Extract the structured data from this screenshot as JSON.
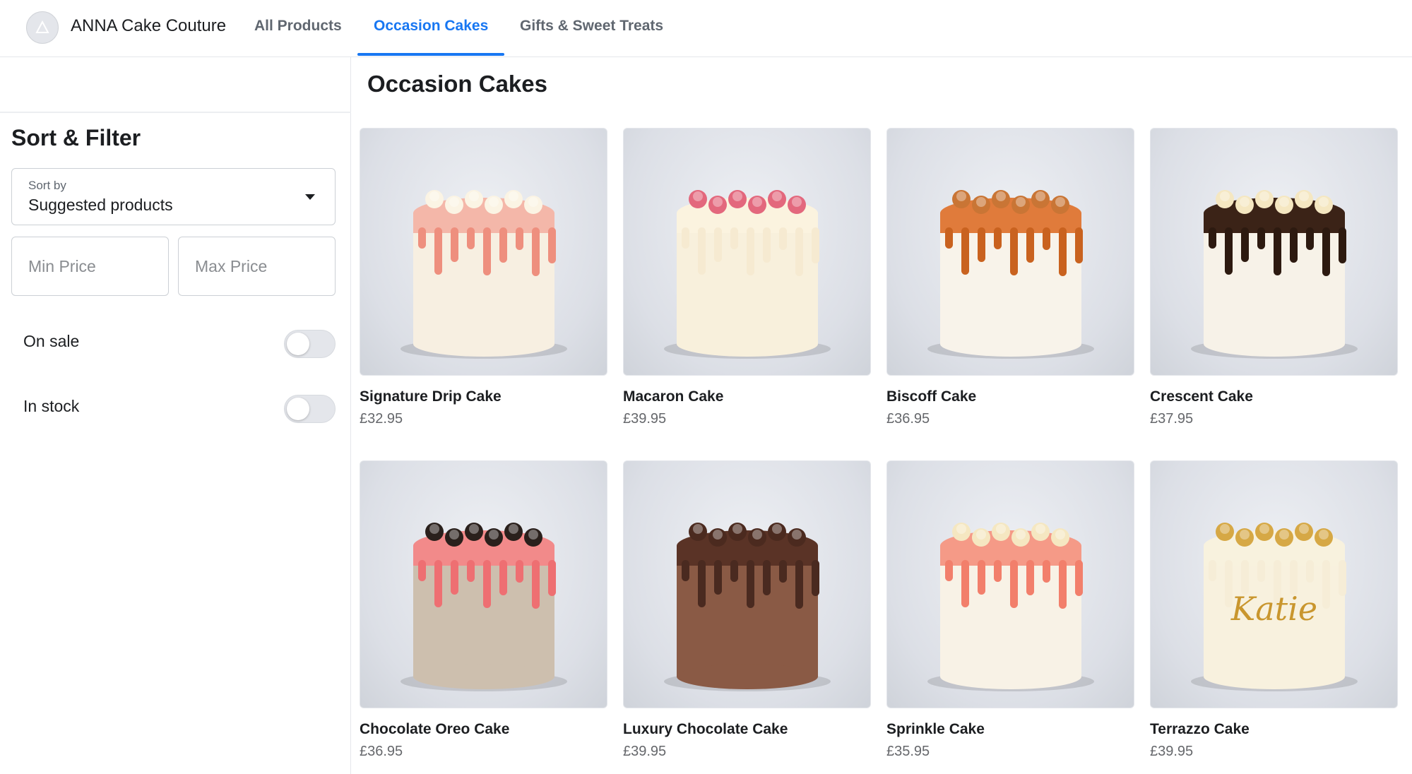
{
  "header": {
    "brand": "ANNA Cake Couture",
    "tabs": [
      {
        "label": "All Products",
        "active": false
      },
      {
        "label": "Occasion Cakes",
        "active": true
      },
      {
        "label": "Gifts & Sweet Treats",
        "active": false
      }
    ]
  },
  "sidebar": {
    "title": "Sort & Filter",
    "sort": {
      "label": "Sort by",
      "value": "Suggested products"
    },
    "min_price": {
      "placeholder": "Min Price",
      "value": ""
    },
    "max_price": {
      "placeholder": "Max Price",
      "value": ""
    },
    "toggles": [
      {
        "label": "On sale",
        "on": false
      },
      {
        "label": "In stock",
        "on": false
      }
    ]
  },
  "main": {
    "title": "Occasion Cakes",
    "products": [
      {
        "name": "Signature Drip Cake",
        "price": "£32.95",
        "icon": "drip-cake-image",
        "frosting": "#f4b7a9",
        "drip": "#ee8f7e",
        "body": "#f7efe1",
        "topper": "#fbf4e4"
      },
      {
        "name": "Macaron Cake",
        "price": "£39.95",
        "icon": "macaron-cake-image",
        "frosting": "#fbf3df",
        "drip": "#f6ead1",
        "body": "#f8f0dc",
        "topper": "#e3687d"
      },
      {
        "name": "Biscoff Cake",
        "price": "£36.95",
        "icon": "biscoff-cake-image",
        "frosting": "#e07b3b",
        "drip": "#c9621f",
        "body": "#f8f3ea",
        "topper": "#c97535"
      },
      {
        "name": "Crescent Cake",
        "price": "£37.95",
        "icon": "crescent-cake-image",
        "frosting": "#3b2317",
        "drip": "#2d1a10",
        "body": "#f7f2e8",
        "topper": "#f5e7c1"
      },
      {
        "name": "Chocolate Oreo Cake",
        "price": "£36.95",
        "icon": "oreo-cake-image",
        "frosting": "#f28a8a",
        "drip": "#ee6f72",
        "body": "#cdbfae",
        "topper": "#2a201c"
      },
      {
        "name": "Luxury Chocolate Cake",
        "price": "£39.95",
        "icon": "chocolate-cake-image",
        "frosting": "#5a3326",
        "drip": "#4a2a20",
        "body": "#8a5a45",
        "topper": "#4b2a1f"
      },
      {
        "name": "Sprinkle Cake",
        "price": "£35.95",
        "icon": "sprinkle-cake-image",
        "frosting": "#f59a87",
        "drip": "#f27f6b",
        "body": "#f8f2e6",
        "topper": "#f5e7c1"
      },
      {
        "name": "Terrazzo Cake",
        "price": "£39.95",
        "icon": "terrazzo-cake-image",
        "frosting": "#f8f2de",
        "drip": "#f6edd7",
        "body": "#f8f1de",
        "topper": "#d6a845",
        "lettering": "Katie"
      }
    ]
  }
}
